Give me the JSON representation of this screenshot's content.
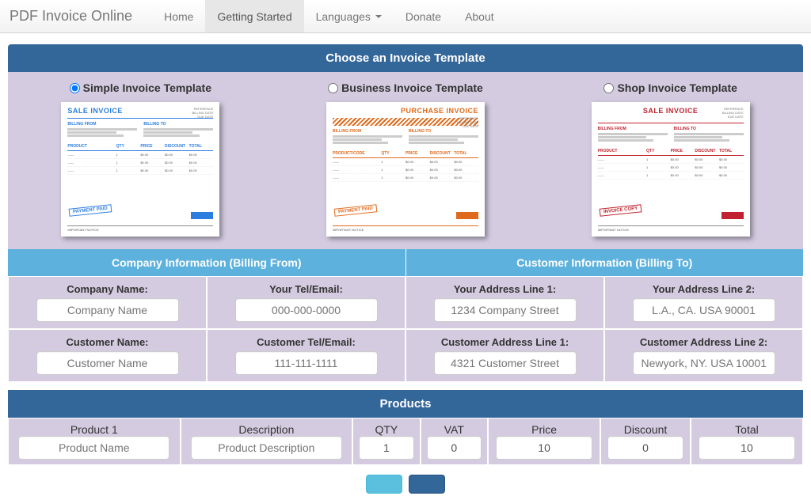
{
  "brand": "PDF Invoice Online",
  "nav": {
    "home": "Home",
    "getting_started": "Getting Started",
    "languages": "Languages",
    "donate": "Donate",
    "about": "About"
  },
  "headers": {
    "choose_template": "Choose an Invoice Template",
    "company_info": "Company Information (Billing From)",
    "customer_info": "Customer Information (Billing To)",
    "products": "Products"
  },
  "templates": {
    "simple": {
      "label": "Simple Invoice Template",
      "title": "SALE INVOICE",
      "stamp": "PAYMENT PAID",
      "col1": "BILLING FROM",
      "col2": "BILLING TO"
    },
    "business": {
      "label": "Business Invoice Template",
      "title": "PURCHASE INVOICE",
      "stamp": "PAYMENT PAID",
      "col1": "BILLING FROM",
      "col2": "BILLING TO"
    },
    "shop": {
      "label": "Shop Invoice Template",
      "title": "SALE INVOICE",
      "stamp": "INVOICE COPY",
      "col1": "BILLING FROM",
      "col2": "BILLING TO"
    }
  },
  "company": {
    "name_label": "Company Name:",
    "name_ph": "Company Name",
    "tel_label": "Your Tel/Email:",
    "tel_ph": "000-000-0000",
    "addr1_label": "Your Address Line 1:",
    "addr1_ph": "1234 Company Street",
    "addr2_label": "Your Address Line 2:",
    "addr2_ph": "L.A., CA. USA 90001"
  },
  "customer": {
    "name_label": "Customer Name:",
    "name_ph": "Customer Name",
    "tel_label": "Customer Tel/Email:",
    "tel_ph": "111-111-1111",
    "addr1_label": "Customer Address Line 1:",
    "addr1_ph": "4321 Customer Street",
    "addr2_label": "Customer Address Line 2:",
    "addr2_ph": "Newyork, NY. USA 10001"
  },
  "product_headers": {
    "product": "Product 1",
    "desc": "Description",
    "qty": "QTY",
    "vat": "VAT",
    "price": "Price",
    "discount": "Discount",
    "total": "Total"
  },
  "product_row": {
    "name_ph": "Product Name",
    "desc_ph": "Product Description",
    "qty": "1",
    "vat": "0",
    "price": "10",
    "discount": "0",
    "total": "10"
  }
}
